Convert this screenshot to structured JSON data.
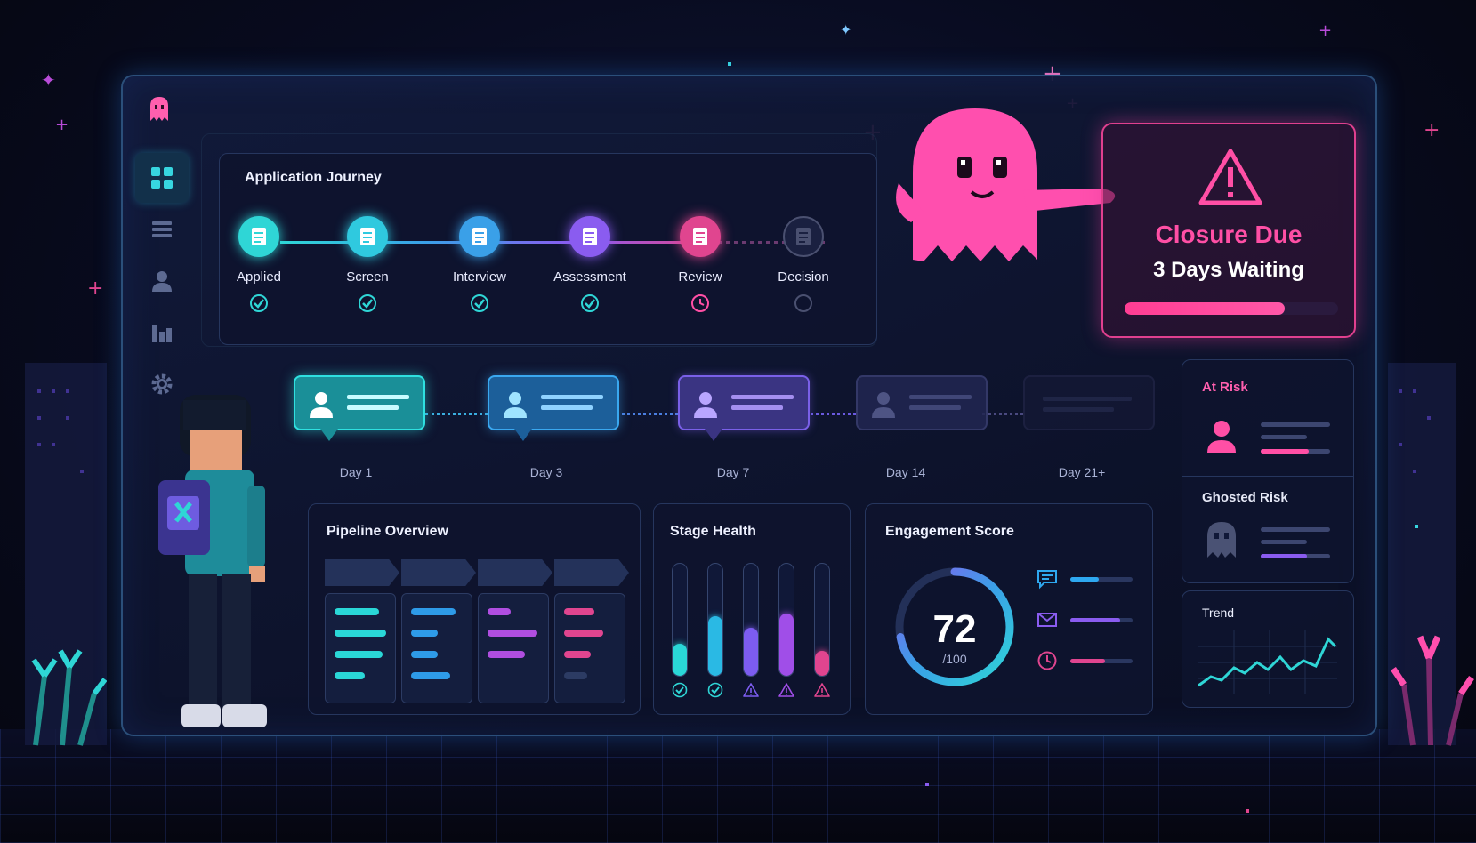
{
  "journey": {
    "title": "Application Journey",
    "steps": [
      {
        "label": "Applied",
        "status": "done",
        "color": "#2fd6d6"
      },
      {
        "label": "Screen",
        "status": "done",
        "color": "#2fc9df"
      },
      {
        "label": "Interview",
        "status": "done",
        "color": "#3aa0e8"
      },
      {
        "label": "Assessment",
        "status": "done",
        "color": "#8a5cf0"
      },
      {
        "label": "Review",
        "status": "in-progress",
        "color": "#e0458f"
      },
      {
        "label": "Decision",
        "status": "pending",
        "color": "#4a5070"
      }
    ]
  },
  "timeline": {
    "days": [
      "Day 1",
      "Day 3",
      "Day 7",
      "Day 14",
      "Day 21+"
    ]
  },
  "alert": {
    "title": "Closure Due",
    "subtitle": "3 Days Waiting",
    "icon": "warning-triangle-icon",
    "progress": 0.75
  },
  "risk": {
    "at_risk_label": "At Risk",
    "ghosted_label": "Ghosted Risk",
    "trend_label": "Trend"
  },
  "pipeline": {
    "title": "Pipeline Overview"
  },
  "health": {
    "title": "Stage Health",
    "bars": [
      {
        "level": 0.28,
        "color": "#2ad7d7",
        "status": "check-icon"
      },
      {
        "level": 0.52,
        "color": "#2ab9e4",
        "status": "check-icon"
      },
      {
        "level": 0.42,
        "color": "#7c5cf0",
        "status": "warning-icon"
      },
      {
        "level": 0.55,
        "color": "#a04ee8",
        "status": "warning-icon"
      },
      {
        "level": 0.22,
        "color": "#e0458f",
        "status": "warning-icon"
      }
    ]
  },
  "engagement": {
    "title": "Engagement Score",
    "score": "72",
    "max_label": "/100",
    "score_value": 0.72,
    "metrics": [
      {
        "icon": "chat-icon",
        "level": 0.45,
        "color": "#2ea8f0"
      },
      {
        "icon": "mail-icon",
        "level": 0.8,
        "color": "#8a5cf0"
      },
      {
        "icon": "clock-icon",
        "level": 0.55,
        "color": "#e0458f"
      }
    ]
  },
  "colors": {
    "accent_cyan": "#2fd6d6",
    "accent_pink": "#ff4fa5",
    "accent_purple": "#8a5cf0"
  }
}
